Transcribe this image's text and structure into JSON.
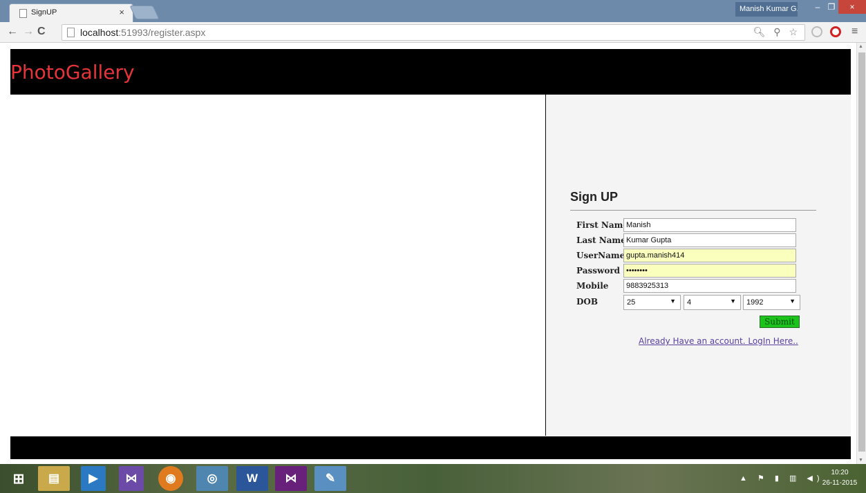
{
  "browser": {
    "tab_title": "SignUP",
    "tab_close": "×",
    "user_name": "Manish Kumar G...",
    "window_min": "–",
    "window_max": "❐",
    "window_close": "×",
    "nav_back": "←",
    "nav_forward": "→",
    "nav_reload": "C",
    "url_host": "localhost",
    "url_path": ":51993/register.aspx",
    "omnibox_icons": "🔍︎ ⚲ ☆",
    "menu": "≡"
  },
  "site": {
    "brand": "PhotoGallery"
  },
  "form": {
    "heading": "Sign UP",
    "first_name_label": "First Name",
    "first_name_value": "Manish",
    "last_name_label": "Last Name",
    "last_name_value": "Kumar Gupta",
    "username_label": "UserName",
    "username_value": "gupta.manish414",
    "password_label": "Password",
    "password_value": "password",
    "mobile_label": "Mobile",
    "mobile_value": "9883925313",
    "dob_label": "DOB",
    "dob_day": "25",
    "dob_month": "4",
    "dob_year": "1992",
    "submit_label": "Submit",
    "login_link": "Already Have an account. LogIn Here.."
  },
  "taskbar": {
    "time": "10:20",
    "date": "26-11-2015"
  },
  "colors": {
    "brand": "#e6343b",
    "submit_bg": "#1bc31b",
    "autofill_bg": "#faffbd",
    "link": "#5a3fa0"
  }
}
